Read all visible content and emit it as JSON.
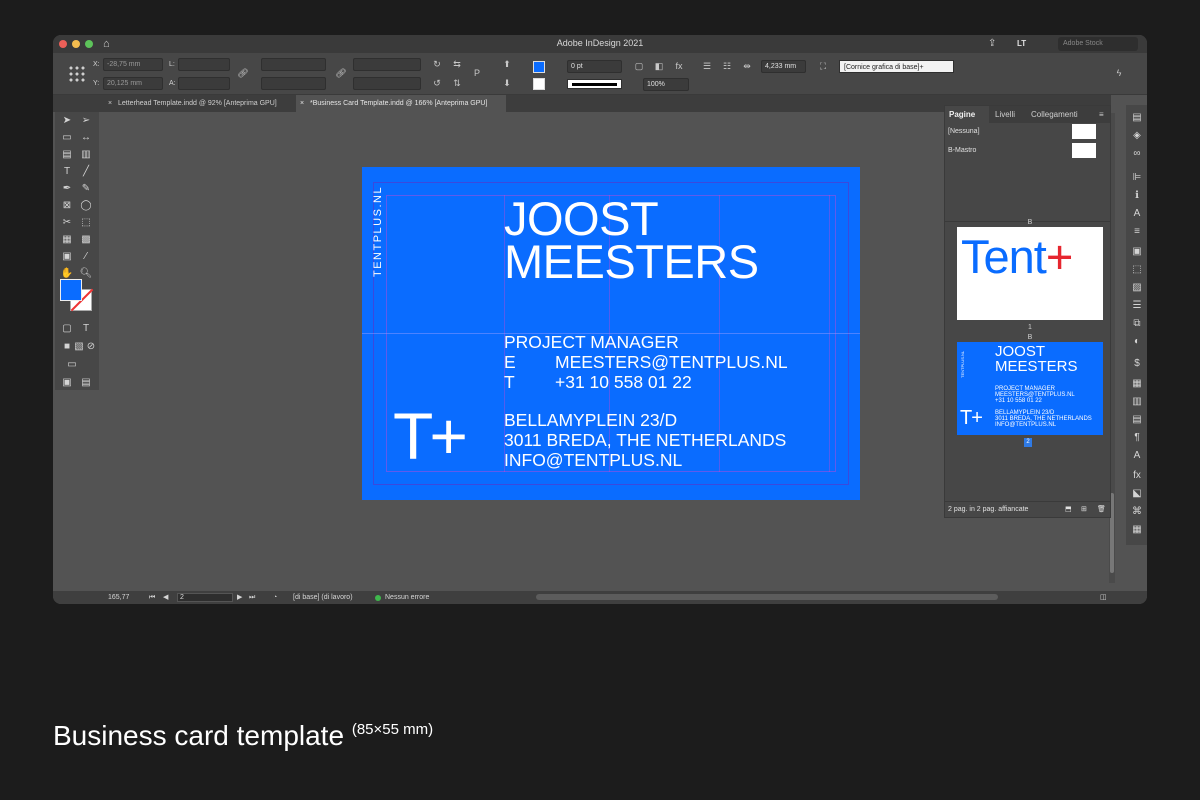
{
  "window": {
    "title": "Adobe InDesign 2021",
    "workspace": "LT",
    "stock_search_placeholder": "Adobe Stock"
  },
  "control": {
    "x_label": "X:",
    "x_value": "-28,75 mm",
    "y_label": "Y:",
    "y_value": "20,125 mm",
    "l_label": "L:",
    "a_label": "A:",
    "stroke_weight": "0 pt",
    "opacity": "100%",
    "gap_value": "4,233 mm",
    "object_style": "[Cornice grafica di base]+",
    "fill_color": "#0a6cff"
  },
  "tabs": [
    {
      "label": "Letterhead Template.indd @ 92% [Anteprima GPU]"
    },
    {
      "label": "*Business Card Template.indd @ 166% [Anteprima GPU]"
    }
  ],
  "card": {
    "vertical_url": "TENTPLUS.NL",
    "name_line1": "JOOST",
    "name_line2": "MEESTERS",
    "role": "PROJECT MANAGER",
    "email_key": "E",
    "email": "MEESTERS@TENTPLUS.NL",
    "phone_key": "T",
    "phone": "+31 10 558 01 22",
    "address1": "BELLAMYPLEIN 23/D",
    "address2": "3011  BREDA, THE NETHERLANDS",
    "address3": "INFO@TENTPLUS.NL",
    "logo": "T+"
  },
  "panel": {
    "tabs": [
      "Pagine",
      "Livelli",
      "Collegamenti"
    ],
    "masters": [
      "[Nessuna]",
      "B-Mastro"
    ],
    "page1_master_label": "B",
    "page1_logo_text": "Tent",
    "page1_logo_plus": "+",
    "page1_number": "1",
    "page2_master_label": "B",
    "page2_number": "2",
    "footer": "2 pag. in 2 pag. affiancate"
  },
  "status": {
    "zoom": "165,77",
    "page": "2",
    "preflight_profile": "[di base] (di lavoro)",
    "errors": "Nessun errore"
  },
  "caption": {
    "title": "Business card template",
    "dims": "(85×55 mm)"
  }
}
